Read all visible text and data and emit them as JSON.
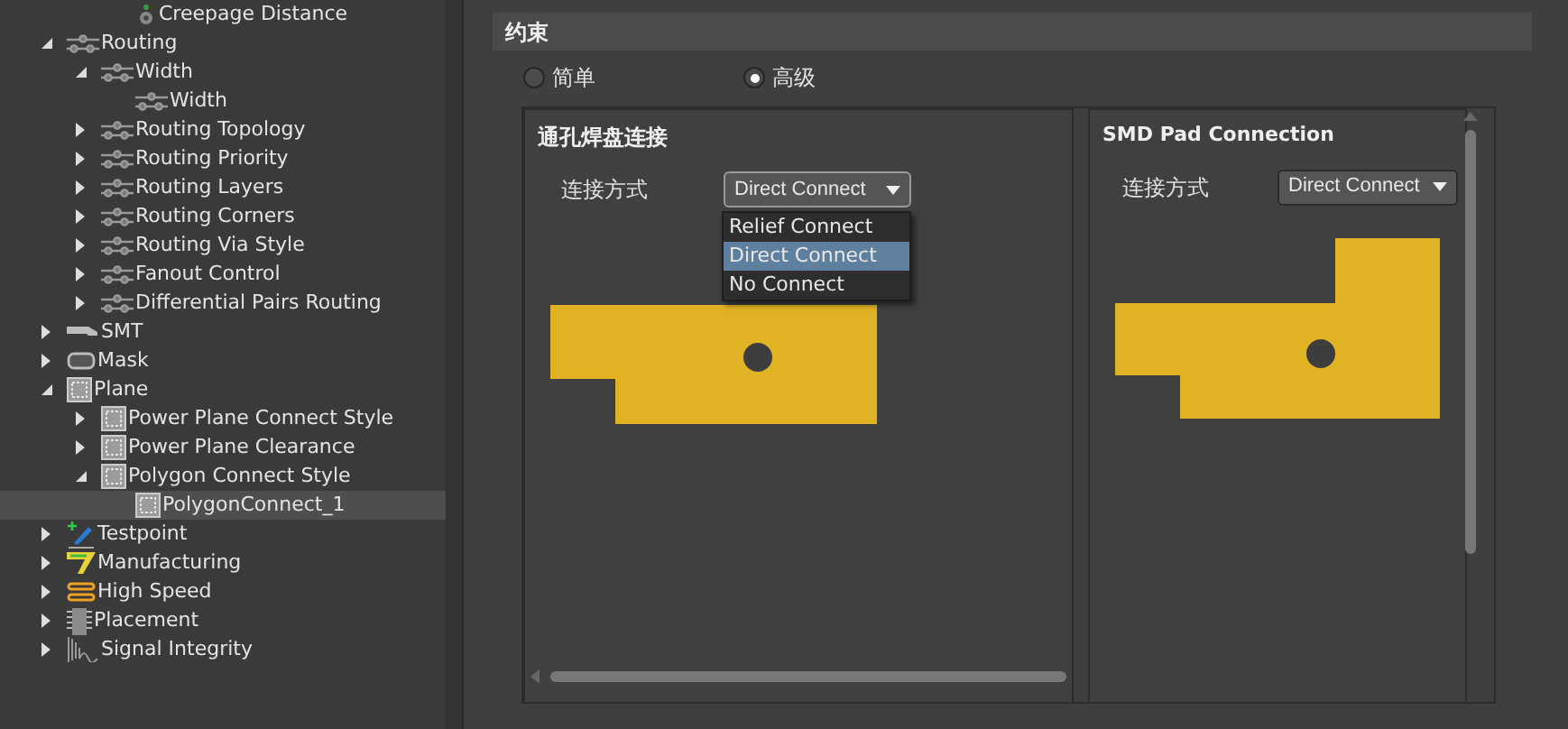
{
  "tree": {
    "scrolled_children": [
      {
        "label": "Creepage Distance",
        "kind": "clearance",
        "selected": false
      }
    ],
    "items": [
      {
        "label": "Routing",
        "kind": "routing",
        "expanded": true,
        "selected": false,
        "children": [
          {
            "label": "Width",
            "kind": "routing",
            "expanded": true,
            "selected": false,
            "children": [
              {
                "label": "Width",
                "kind": "routing",
                "selected": false
              }
            ]
          },
          {
            "label": "Routing Topology",
            "kind": "routing",
            "expanded": false,
            "selected": false
          },
          {
            "label": "Routing Priority",
            "kind": "routing",
            "expanded": false,
            "selected": false
          },
          {
            "label": "Routing Layers",
            "kind": "routing",
            "expanded": false,
            "selected": false
          },
          {
            "label": "Routing Corners",
            "kind": "routing",
            "expanded": false,
            "selected": false
          },
          {
            "label": "Routing Via Style",
            "kind": "routing",
            "expanded": false,
            "selected": false
          },
          {
            "label": "Fanout Control",
            "kind": "routing",
            "expanded": false,
            "selected": false
          },
          {
            "label": "Differential Pairs Routing",
            "kind": "routing",
            "expanded": false,
            "selected": false
          }
        ]
      },
      {
        "label": "SMT",
        "kind": "smt",
        "expanded": false,
        "selected": false
      },
      {
        "label": "Mask",
        "kind": "mask",
        "expanded": false,
        "selected": false
      },
      {
        "label": "Plane",
        "kind": "plane",
        "expanded": true,
        "selected": false,
        "children": [
          {
            "label": "Power Plane Connect Style",
            "kind": "plane",
            "expanded": false,
            "selected": false
          },
          {
            "label": "Power Plane Clearance",
            "kind": "plane",
            "expanded": false,
            "selected": false
          },
          {
            "label": "Polygon Connect Style",
            "kind": "plane",
            "expanded": true,
            "selected": false,
            "children": [
              {
                "label": "PolygonConnect_1",
                "kind": "plane",
                "selected": true
              }
            ]
          }
        ]
      },
      {
        "label": "Testpoint",
        "kind": "testpoint",
        "expanded": false,
        "selected": false
      },
      {
        "label": "Manufacturing",
        "kind": "manufacturing",
        "expanded": false,
        "selected": false
      },
      {
        "label": "High Speed",
        "kind": "highspeed",
        "expanded": false,
        "selected": false
      },
      {
        "label": "Placement",
        "kind": "placement",
        "expanded": false,
        "selected": false
      },
      {
        "label": "Signal Integrity",
        "kind": "signal",
        "expanded": false,
        "selected": false
      }
    ]
  },
  "constraints": {
    "title": "约束",
    "modes": [
      {
        "label": "简单",
        "selected": false
      },
      {
        "label": "高级",
        "selected": true
      }
    ],
    "panels": [
      {
        "title": "通孔焊盘连接",
        "field_label": "连接方式",
        "value": "Direct Connect",
        "expanded": true,
        "options": [
          {
            "label": "Relief Connect",
            "selected": false
          },
          {
            "label": "Direct Connect",
            "selected": true
          },
          {
            "label": "No Connect",
            "selected": false
          }
        ]
      },
      {
        "title": "SMD Pad Connection",
        "field_label": "连接方式",
        "value": "Direct Connect",
        "expanded": false
      }
    ]
  }
}
